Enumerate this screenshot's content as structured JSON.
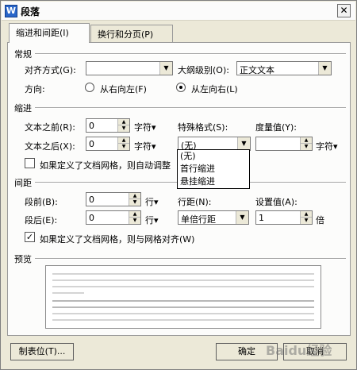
{
  "window": {
    "title": "段落",
    "icon_text": "W"
  },
  "tabs": [
    {
      "label": "缩进和间距(I)"
    },
    {
      "label": "换行和分页(P)"
    }
  ],
  "general": {
    "heading": "常规",
    "alignment_label": "对齐方式(G):",
    "alignment_value": "",
    "outline_label": "大纲级别(O):",
    "outline_value": "正文文本",
    "direction_label": "方向:",
    "rtl_label": "从右向左(F)",
    "ltr_label": "从左向右(L)"
  },
  "indent": {
    "heading": "缩进",
    "before_label": "文本之前(R):",
    "before_value": "0",
    "before_unit": "字符▾",
    "after_label": "文本之后(X):",
    "after_value": "0",
    "after_unit": "字符▾",
    "special_label": "特殊格式(S):",
    "special_value": "(无)",
    "measure_label": "度量值(Y):",
    "measure_value": "",
    "measure_unit": "字符▾",
    "grid_check_label": "如果定义了文档网格，则自动调整",
    "special_options": [
      "(无)",
      "首行缩进",
      "悬挂缩进"
    ]
  },
  "spacing": {
    "heading": "间距",
    "before_label": "段前(B):",
    "before_value": "0",
    "before_unit": "行▾",
    "after_label": "段后(E):",
    "after_value": "0",
    "after_unit": "行▾",
    "line_label": "行距(N):",
    "line_value": "单倍行距",
    "setting_label": "设置值(A):",
    "setting_value": "1",
    "setting_unit": "倍",
    "grid_check_label": "如果定义了文档网格，则与网格对齐(W)"
  },
  "preview": {
    "heading": "预览"
  },
  "buttons": {
    "tabs_label": "制表位(T)...",
    "ok_label": "确定",
    "cancel_label": "取消"
  },
  "watermark": "Baidu经验"
}
